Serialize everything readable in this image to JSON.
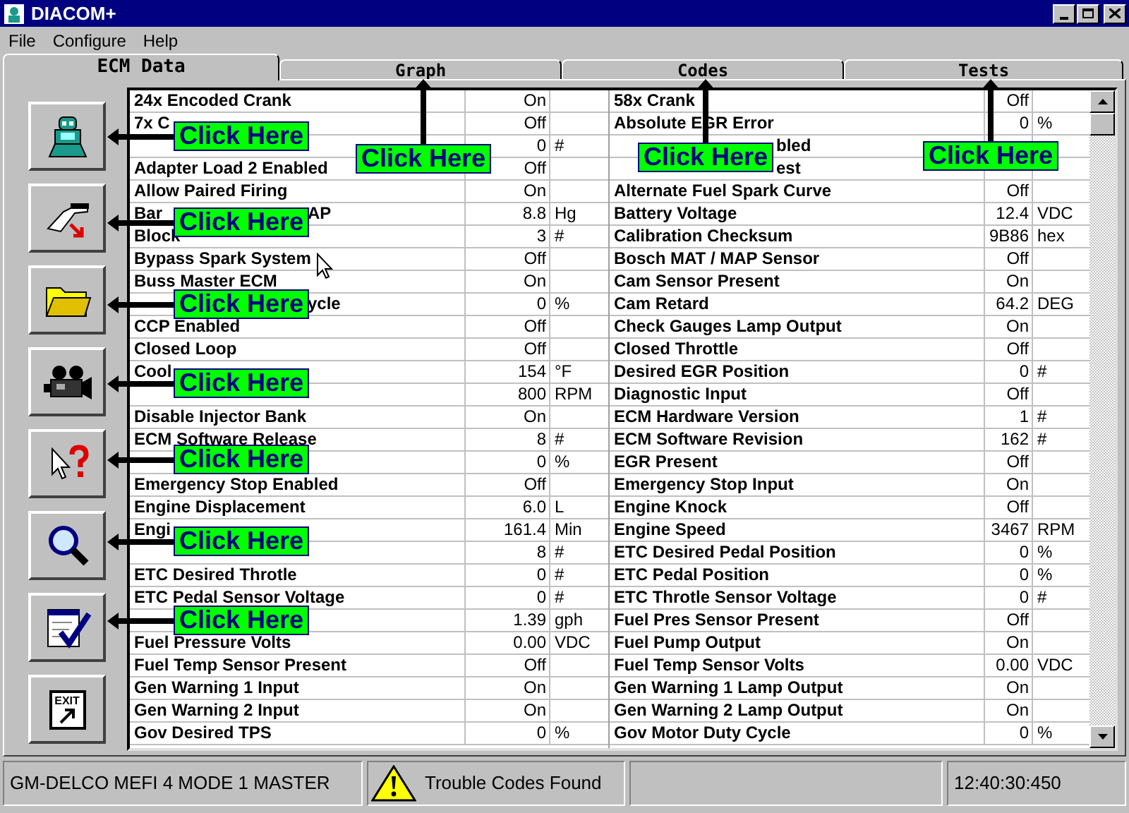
{
  "window": {
    "title": "DIACOM+"
  },
  "menu": [
    "File",
    "Configure",
    "Help"
  ],
  "tabs": [
    {
      "label": "ECM Data",
      "selected": true
    },
    {
      "label": "Graph",
      "selected": false,
      "callout": "Click Here"
    },
    {
      "label": "Codes",
      "selected": false,
      "callout": "Click Here"
    },
    {
      "label": "Tests",
      "selected": false,
      "callout": "Click Here"
    }
  ],
  "toolbar": [
    {
      "kind": "robot",
      "callout": "Click Here"
    },
    {
      "kind": "connector",
      "callout": "Click Here"
    },
    {
      "kind": "folder",
      "callout": "Click Here"
    },
    {
      "kind": "camera",
      "callout": "Click Here"
    },
    {
      "kind": "help",
      "callout": "Click Here"
    },
    {
      "kind": "search",
      "callout": "Click Here"
    },
    {
      "kind": "checklist",
      "callout": "Click Here"
    },
    {
      "kind": "exit",
      "label": "EXIT"
    }
  ],
  "left_table": [
    {
      "label": "24x Encoded Crank",
      "value": "On"
    },
    {
      "label": "7x C",
      "value": "Off"
    },
    {
      "value": "0",
      "unit": "#"
    },
    {
      "label": "Adapter Load 2 Enabled",
      "value": "Off"
    },
    {
      "label": "Allow Paired Firing",
      "value": "On"
    },
    {
      "label": "Bar",
      "label_end": "AP",
      "value": "8.8",
      "unit": "Hg"
    },
    {
      "label": "Block",
      "value": "3",
      "unit": "#"
    },
    {
      "label": "Bypass Spark System",
      "value": "Off"
    },
    {
      "label": "Buss Master ECM",
      "value": "On"
    },
    {
      "label_end": "ycle",
      "value": "0",
      "unit": "%"
    },
    {
      "label": "CCP Enabled",
      "value": "Off"
    },
    {
      "label": "Closed Loop",
      "value": "Off"
    },
    {
      "label": "Cool",
      "value": "154",
      "unit": "°F"
    },
    {
      "value": "800",
      "unit": "RPM"
    },
    {
      "label": "Disable Injector Bank",
      "value": "On"
    },
    {
      "label": "ECM Software Release",
      "value": "8",
      "unit": "#"
    },
    {
      "value": "0",
      "unit": "%"
    },
    {
      "label": "Emergency Stop Enabled",
      "value": "Off"
    },
    {
      "label": "Engine Displacement",
      "value": "6.0",
      "unit": "L"
    },
    {
      "label": "Engi",
      "value": "161.4",
      "unit": "Min"
    },
    {
      "value": "8",
      "unit": "#"
    },
    {
      "label": "ETC Desired Throtle",
      "value": "0",
      "unit": "#"
    },
    {
      "label": "ETC Pedal Sensor Voltage",
      "value": "0",
      "unit": "#"
    },
    {
      "value": "1.39",
      "unit": "gph"
    },
    {
      "label": "Fuel Pressure Volts",
      "value": "0.00",
      "unit": "VDC"
    },
    {
      "label": "Fuel Temp Sensor Present",
      "value": "Off"
    },
    {
      "label": "Gen Warning 1 Input",
      "value": "On"
    },
    {
      "label": "Gen Warning 2 Input",
      "value": "On"
    },
    {
      "label": "Gov Desired TPS",
      "value": "0",
      "unit": "%"
    }
  ],
  "right_table": [
    {
      "label": "58x Crank",
      "value": "Off"
    },
    {
      "label": "Absolute EGR Error",
      "value": "0",
      "unit": "%"
    },
    {
      "label_end": "bled"
    },
    {
      "label_end": "est"
    },
    {
      "label": "Alternate Fuel Spark Curve",
      "value": "Off"
    },
    {
      "label": "Battery Voltage",
      "value": "12.4",
      "unit": "VDC"
    },
    {
      "label": "Calibration Checksum",
      "value": "9B86",
      "unit": "hex"
    },
    {
      "label": "Bosch MAT / MAP Sensor",
      "value": "Off"
    },
    {
      "label": "Cam Sensor Present",
      "value": "On"
    },
    {
      "label": "Cam Retard",
      "value": "64.2",
      "unit": "DEG"
    },
    {
      "label": "Check Gauges Lamp Output",
      "value": "On"
    },
    {
      "label": "Closed Throttle",
      "value": "Off"
    },
    {
      "label": "Desired EGR Position",
      "value": "0",
      "unit": "#"
    },
    {
      "label": "Diagnostic Input",
      "value": "Off"
    },
    {
      "label": "ECM Hardware Version",
      "value": "1",
      "unit": "#"
    },
    {
      "label": "ECM Software Revision",
      "value": "162",
      "unit": "#"
    },
    {
      "label": "EGR Present",
      "value": "Off"
    },
    {
      "label": "Emergency Stop Input",
      "value": "On"
    },
    {
      "label": "Engine Knock",
      "value": "Off"
    },
    {
      "label": "Engine Speed",
      "value": "3467",
      "unit": "RPM"
    },
    {
      "label": "ETC Desired Pedal Position",
      "value": "0",
      "unit": "%"
    },
    {
      "label": "ETC Pedal Position",
      "value": "0",
      "unit": "%"
    },
    {
      "label": "ETC Throtle Sensor Voltage",
      "value": "0",
      "unit": "#"
    },
    {
      "label": "Fuel Pres Sensor Present",
      "value": "Off"
    },
    {
      "label": "Fuel Pump Output",
      "value": "On"
    },
    {
      "label": "Fuel Temp Sensor Volts",
      "value": "0.00",
      "unit": "VDC"
    },
    {
      "label": "Gen Warning 1 Lamp Output",
      "value": "On"
    },
    {
      "label": "Gen Warning 2 Lamp Output",
      "value": "On"
    },
    {
      "label": "Gov Motor Duty Cycle",
      "value": "0",
      "unit": "%"
    }
  ],
  "status_bar": {
    "device": "GM-DELCO MEFI 4 MODE 1 MASTER",
    "warning": "Trouble Codes Found",
    "time": "12:40:30:450"
  }
}
